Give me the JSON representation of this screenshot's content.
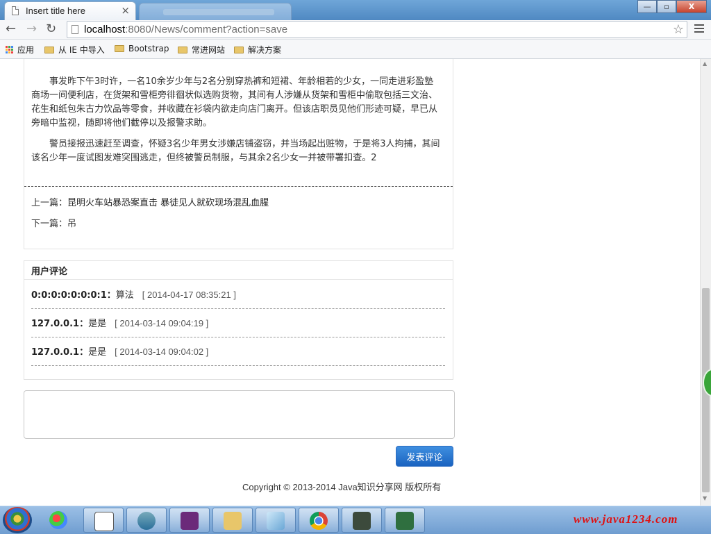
{
  "browser": {
    "tab_title": "Insert title here",
    "tab_close": "×",
    "url_host": "localhost",
    "url_rest": ":8080/News/comment?action=save",
    "window_buttons": [
      "—",
      "▫",
      "X"
    ]
  },
  "bookmarks": {
    "items": [
      "应用",
      "从 IE 中导入",
      "Bootstrap",
      "常进网站",
      "解决方案"
    ]
  },
  "article": {
    "paragraph1": "事发昨下午3时许，一名10余岁少年与2名分别穿热裤和短裙、年龄相若的少女，一同走进彩盈塾商场一间便利店，在货架和雪柜旁徘徊状似选购货物，其间有人涉嫌从货架和雪柜中偷取包括三文治、花生和纸包朱古力饮品等零食，并收藏在衫袋内欲走向店门离开。但该店职员见他们形迹可疑，早已从旁暗中监视，随即将他们截停以及报警求助。",
    "paragraph2": "警员接报迅速赶至调查，怀疑3名少年男女涉嫌店铺盗窃，并当场起出赃物，于是将3人拘捕，其间该名少年一度试图发难突围逃走，但终被警员制服，与其余2名少女一并被带署扣查。2",
    "prev_label": "上一篇：",
    "prev_title": "昆明火车站暴恐案直击 暴徒见人就砍现场混乱血腥",
    "next_label": "下一篇：",
    "next_title": "吊"
  },
  "comments": {
    "heading": "用户评论",
    "items": [
      {
        "ip": "0:0:0:0:0:0:0:1：",
        "text": "算法",
        "time": "[ 2014-04-17 08:35:21 ]"
      },
      {
        "ip": "127.0.0.1：",
        "text": "是是",
        "time": "[ 2014-03-14 09:04:19 ]"
      },
      {
        "ip": "127.0.0.1：",
        "text": "是是",
        "time": "[ 2014-03-14 09:04:02 ]"
      }
    ]
  },
  "form": {
    "textarea_value": "",
    "submit_label": "发表评论"
  },
  "footer": {
    "copyright": "Copyright © 2013-2014 Java知识分享网 版权所有"
  },
  "taskbar": {
    "watermark": "www.java1234.com"
  },
  "colors": {
    "accent_button": "#1a63c0",
    "watermark": "#e01010"
  }
}
